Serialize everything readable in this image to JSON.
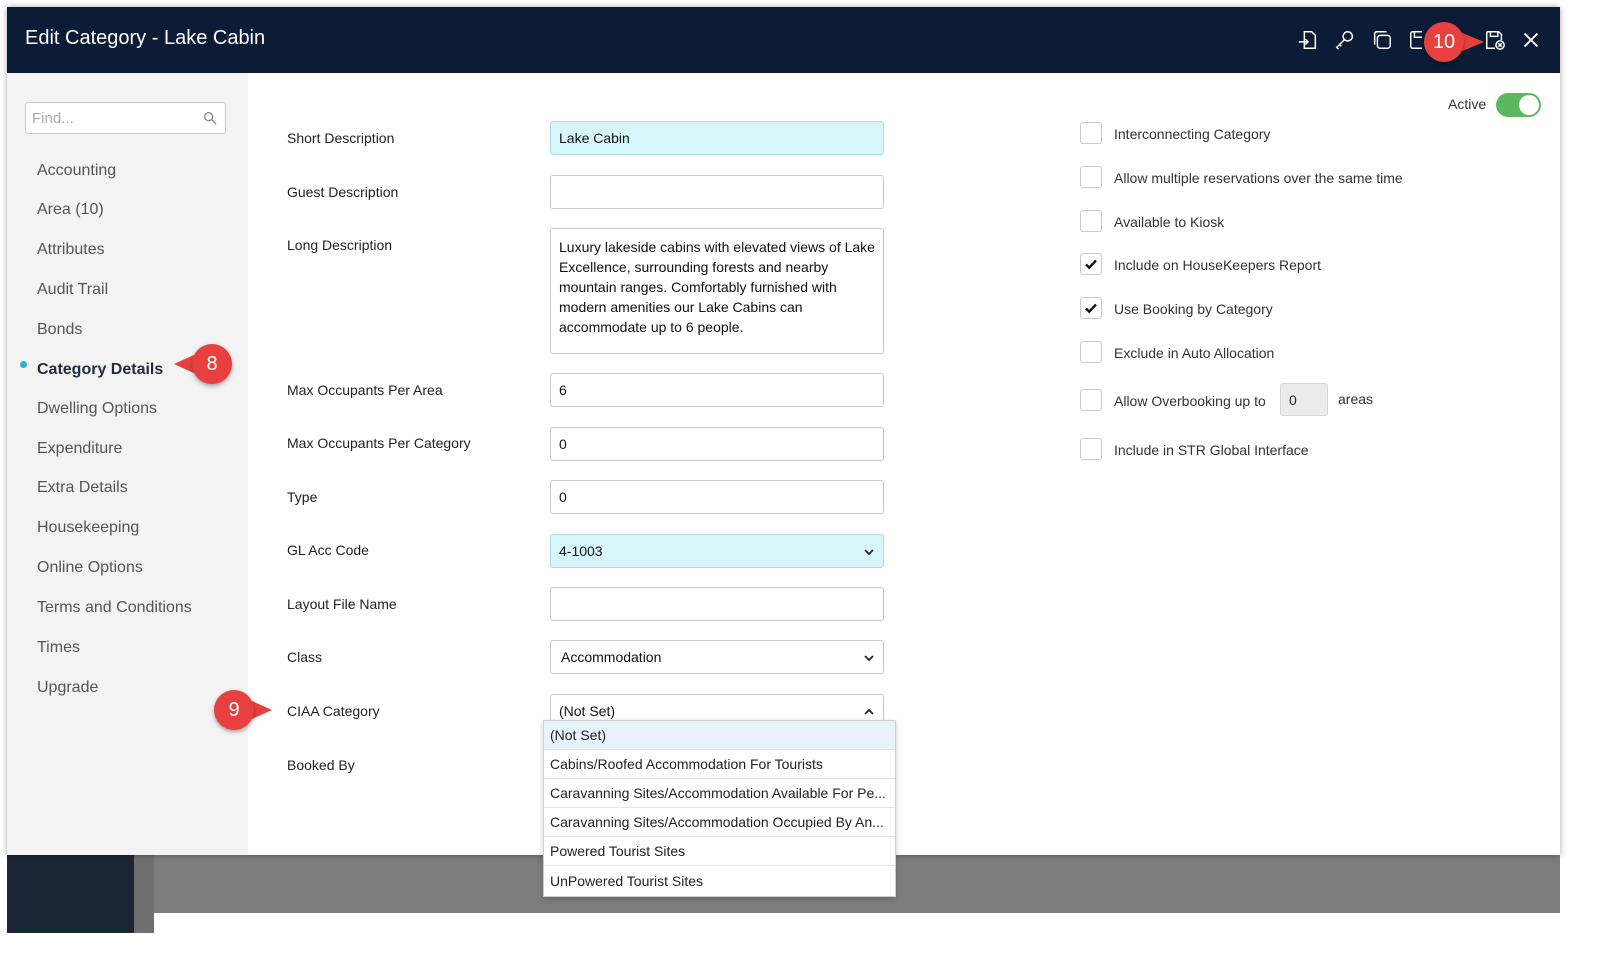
{
  "window": {
    "title": "Edit Category - Lake Cabin"
  },
  "toolbar": {
    "icons": [
      "import-icon",
      "key-icon",
      "copy-icon",
      "save-icon",
      "save-close-icon",
      "close-icon"
    ]
  },
  "sidebar": {
    "search_placeholder": "Find...",
    "items": [
      {
        "label": "Accounting"
      },
      {
        "label": "Area (10)"
      },
      {
        "label": "Attributes"
      },
      {
        "label": "Audit Trail"
      },
      {
        "label": "Bonds"
      },
      {
        "label": "Category Details",
        "active": true
      },
      {
        "label": "Dwelling Options"
      },
      {
        "label": "Expenditure"
      },
      {
        "label": "Extra Details"
      },
      {
        "label": "Housekeeping"
      },
      {
        "label": "Online Options"
      },
      {
        "label": "Terms and Conditions"
      },
      {
        "label": "Times"
      },
      {
        "label": "Upgrade"
      }
    ]
  },
  "form": {
    "short_description": {
      "label": "Short Description",
      "value": "Lake Cabin"
    },
    "guest_description": {
      "label": "Guest Description",
      "value": ""
    },
    "long_description": {
      "label": "Long Description",
      "value": "Luxury lakeside cabins with elevated views of Lake Excellence, surrounding forests and nearby mountain ranges. Comfortably furnished with modern amenities our Lake Cabins can accommodate up to 6 people."
    },
    "max_occ_area": {
      "label": "Max Occupants Per Area",
      "value": "6"
    },
    "max_occ_category": {
      "label": "Max Occupants Per Category",
      "value": "0"
    },
    "type": {
      "label": "Type",
      "value": "0"
    },
    "gl_acc_code": {
      "label": "GL Acc Code",
      "value": "4-1003"
    },
    "layout_file": {
      "label": "Layout File Name",
      "value": ""
    },
    "class": {
      "label": "Class",
      "value": "Accommodation"
    },
    "ciaa_category": {
      "label": "CIAA Category",
      "value": "(Not Set)"
    },
    "booked_by": {
      "label": "Booked By"
    }
  },
  "ciaa_options": [
    "(Not Set)",
    "Cabins/Roofed Accommodation For Tourists",
    "Caravanning Sites/Accommodation Available For Pe...",
    "Caravanning Sites/Accommodation Occupied By An...",
    "Powered Tourist Sites",
    "UnPowered Tourist Sites"
  ],
  "active": {
    "label": "Active",
    "on": true
  },
  "checkboxes": [
    {
      "label": "Interconnecting Category",
      "checked": false
    },
    {
      "label": "Allow multiple reservations over the same time",
      "checked": false
    },
    {
      "label": "Available to Kiosk",
      "checked": false
    },
    {
      "label": "Include on HouseKeepers Report",
      "checked": true
    },
    {
      "label": "Use Booking by Category",
      "checked": true
    },
    {
      "label": "Exclude in Auto Allocation",
      "checked": false
    },
    {
      "label": "Allow Overbooking up to",
      "checked": false
    },
    {
      "label": "Include in STR Global Interface",
      "checked": false
    }
  ],
  "overbooking": {
    "value": "0",
    "unit": "areas"
  },
  "callouts": {
    "c8": "8",
    "c9": "9",
    "c10": "10"
  },
  "colors": {
    "titlebar": "#0c1c36",
    "highlight": "#d7f6f9",
    "toggle_on": "#5cb85c",
    "callout": "#e8403f",
    "active_dot": "#2ab3d6"
  }
}
